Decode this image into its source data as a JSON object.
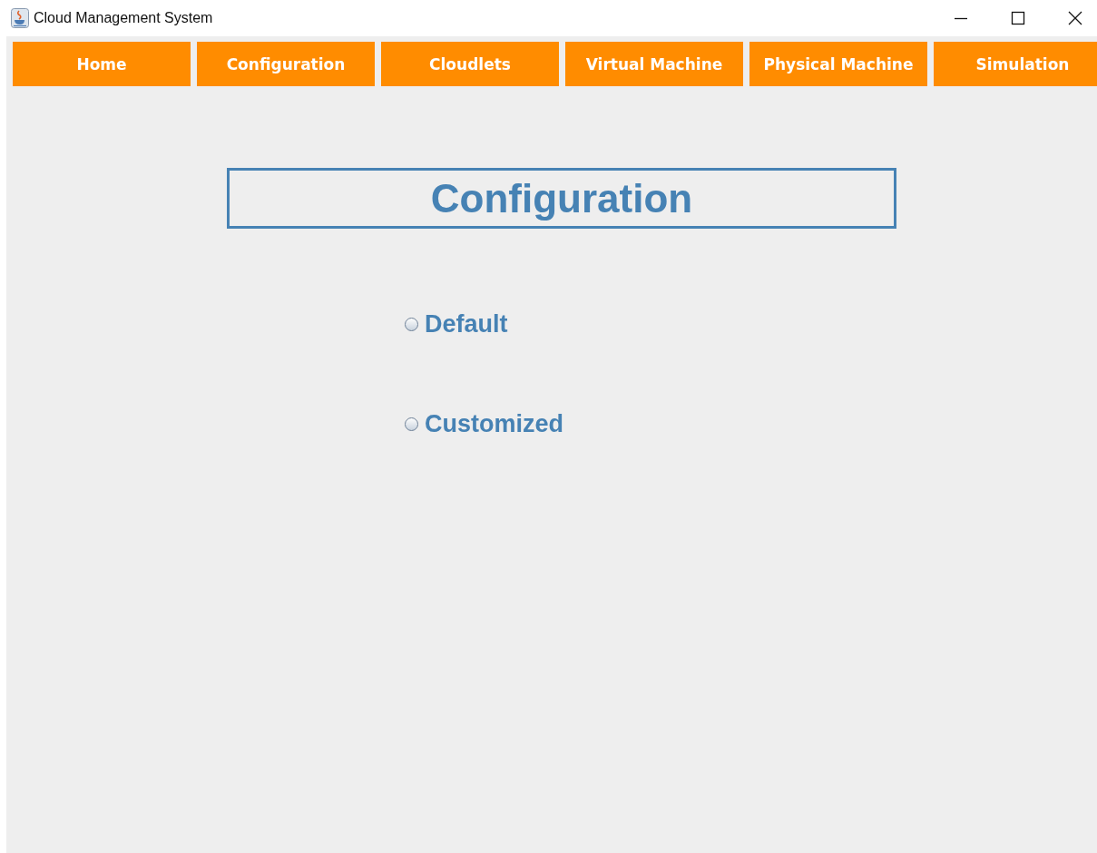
{
  "window": {
    "title": "Cloud Management System"
  },
  "nav": [
    {
      "label": "Home"
    },
    {
      "label": "Configuration"
    },
    {
      "label": "Cloudlets"
    },
    {
      "label": "Virtual Machine"
    },
    {
      "label": "Physical Machine"
    },
    {
      "label": "Simulation"
    }
  ],
  "heading": "Configuration",
  "options": [
    {
      "label": "Default",
      "checked": false
    },
    {
      "label": "Customized",
      "checked": false
    }
  ]
}
